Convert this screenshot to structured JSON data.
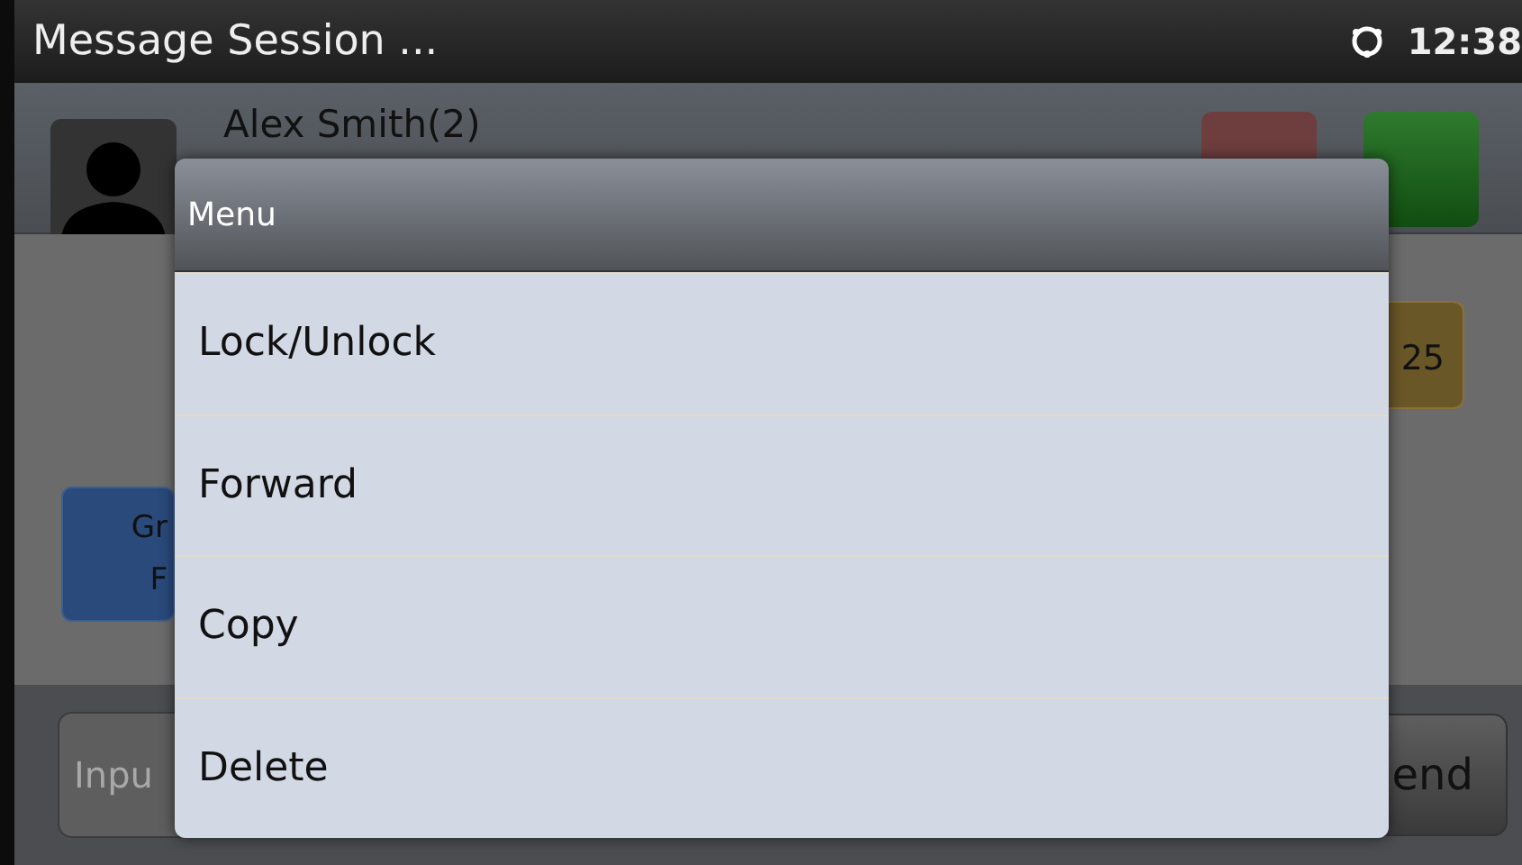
{
  "status_bar": {
    "title": "Message Session ...",
    "time": "12:38"
  },
  "contact": {
    "name": "Alex Smith(2)"
  },
  "messages": [
    {
      "kind": "received",
      "text": "25"
    },
    {
      "kind": "sent",
      "lines": [
        "Gr",
        "F"
      ]
    }
  ],
  "input": {
    "placeholder": "Inpu"
  },
  "send_button": "end",
  "menu": {
    "title": "Menu",
    "items": [
      {
        "label": "Lock/Unlock"
      },
      {
        "label": "Forward"
      },
      {
        "label": "Copy"
      },
      {
        "label": "Delete"
      }
    ]
  }
}
